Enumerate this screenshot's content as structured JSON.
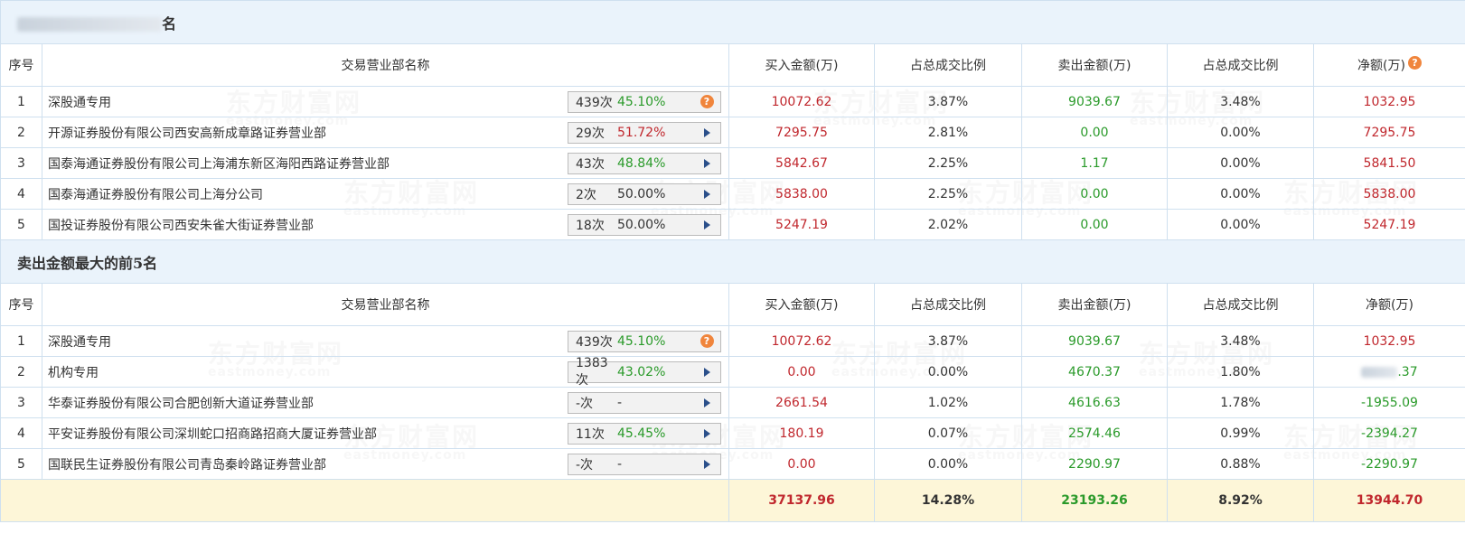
{
  "section1": {
    "title_suffix": "名"
  },
  "section2": {
    "title": "卖出金额最大的前5名"
  },
  "headers": [
    "序号",
    "交易营业部名称",
    "买入金额(万)",
    "占总成交比例",
    "卖出金额(万)",
    "占总成交比例",
    "净额(万)"
  ],
  "buy_rows": [
    {
      "no": "1",
      "name": "深股通专用",
      "count": "439次",
      "pct": "45.10%",
      "pct_color": "green",
      "action": "help",
      "buy": "10072.62",
      "buy_ratio": "3.87%",
      "sell": "9039.67",
      "sell_ratio": "3.48%",
      "net": "1032.95",
      "net_color": "red"
    },
    {
      "no": "2",
      "name": "开源证券股份有限公司西安高新成章路证券营业部",
      "count": "29次",
      "pct": "51.72%",
      "pct_color": "red",
      "action": "arrow",
      "buy": "7295.75",
      "buy_ratio": "2.81%",
      "sell": "0.00",
      "sell_ratio": "0.00%",
      "net": "7295.75",
      "net_color": "red"
    },
    {
      "no": "3",
      "name": "国泰海通证券股份有限公司上海浦东新区海阳西路证券营业部",
      "count": "43次",
      "pct": "48.84%",
      "pct_color": "green",
      "action": "arrow",
      "buy": "5842.67",
      "buy_ratio": "2.25%",
      "sell": "1.17",
      "sell_ratio": "0.00%",
      "net": "5841.50",
      "net_color": "red"
    },
    {
      "no": "4",
      "name": "国泰海通证券股份有限公司上海分公司",
      "count": "2次",
      "pct": "50.00%",
      "pct_color": "plain",
      "action": "arrow",
      "buy": "5838.00",
      "buy_ratio": "2.25%",
      "sell": "0.00",
      "sell_ratio": "0.00%",
      "net": "5838.00",
      "net_color": "red"
    },
    {
      "no": "5",
      "name": "国投证券股份有限公司西安朱雀大街证券营业部",
      "count": "18次",
      "pct": "50.00%",
      "pct_color": "plain",
      "action": "arrow",
      "buy": "5247.19",
      "buy_ratio": "2.02%",
      "sell": "0.00",
      "sell_ratio": "0.00%",
      "net": "5247.19",
      "net_color": "red"
    }
  ],
  "sell_rows": [
    {
      "no": "1",
      "name": "深股通专用",
      "count": "439次",
      "pct": "45.10%",
      "pct_color": "green",
      "action": "help",
      "buy": "10072.62",
      "buy_ratio": "3.87%",
      "sell": "9039.67",
      "sell_ratio": "3.48%",
      "net": "1032.95",
      "net_color": "red"
    },
    {
      "no": "2",
      "name": "机构专用",
      "count": "1383次",
      "pct": "43.02%",
      "pct_color": "green",
      "action": "arrow",
      "buy": "0.00",
      "buy_ratio": "0.00%",
      "sell": "4670.37",
      "sell_ratio": "1.80%",
      "net": ".37",
      "net_color": "green"
    },
    {
      "no": "3",
      "name": "华泰证券股份有限公司合肥创新大道证券营业部",
      "count": "-次",
      "pct": "-",
      "pct_color": "plain",
      "action": "arrow",
      "buy": "2661.54",
      "buy_ratio": "1.02%",
      "sell": "4616.63",
      "sell_ratio": "1.78%",
      "net": "-1955.09",
      "net_color": "green"
    },
    {
      "no": "4",
      "name": "平安证券股份有限公司深圳蛇口招商路招商大厦证券营业部",
      "count": "11次",
      "pct": "45.45%",
      "pct_color": "green",
      "action": "arrow",
      "buy": "180.19",
      "buy_ratio": "0.07%",
      "sell": "2574.46",
      "sell_ratio": "0.99%",
      "net": "-2394.27",
      "net_color": "green"
    },
    {
      "no": "5",
      "name": "国联民生证券股份有限公司青岛秦岭路证券营业部",
      "count": "-次",
      "pct": "-",
      "pct_color": "plain",
      "action": "arrow",
      "buy": "0.00",
      "buy_ratio": "0.00%",
      "sell": "2290.97",
      "sell_ratio": "0.88%",
      "net": "-2290.97",
      "net_color": "green"
    }
  ],
  "totals": {
    "buy": "37137.96",
    "buy_ratio": "14.28%",
    "sell": "23193.26",
    "sell_ratio": "8.92%",
    "net": "13944.70"
  },
  "watermark": {
    "cn": "东方财富网",
    "en": "eastmoney.com"
  },
  "colors": {
    "red": "#c0272d",
    "green": "#2a9a2a",
    "header_bg": "#eaf3fb",
    "total_bg": "#fdf6d8",
    "help": "#f0853c"
  }
}
